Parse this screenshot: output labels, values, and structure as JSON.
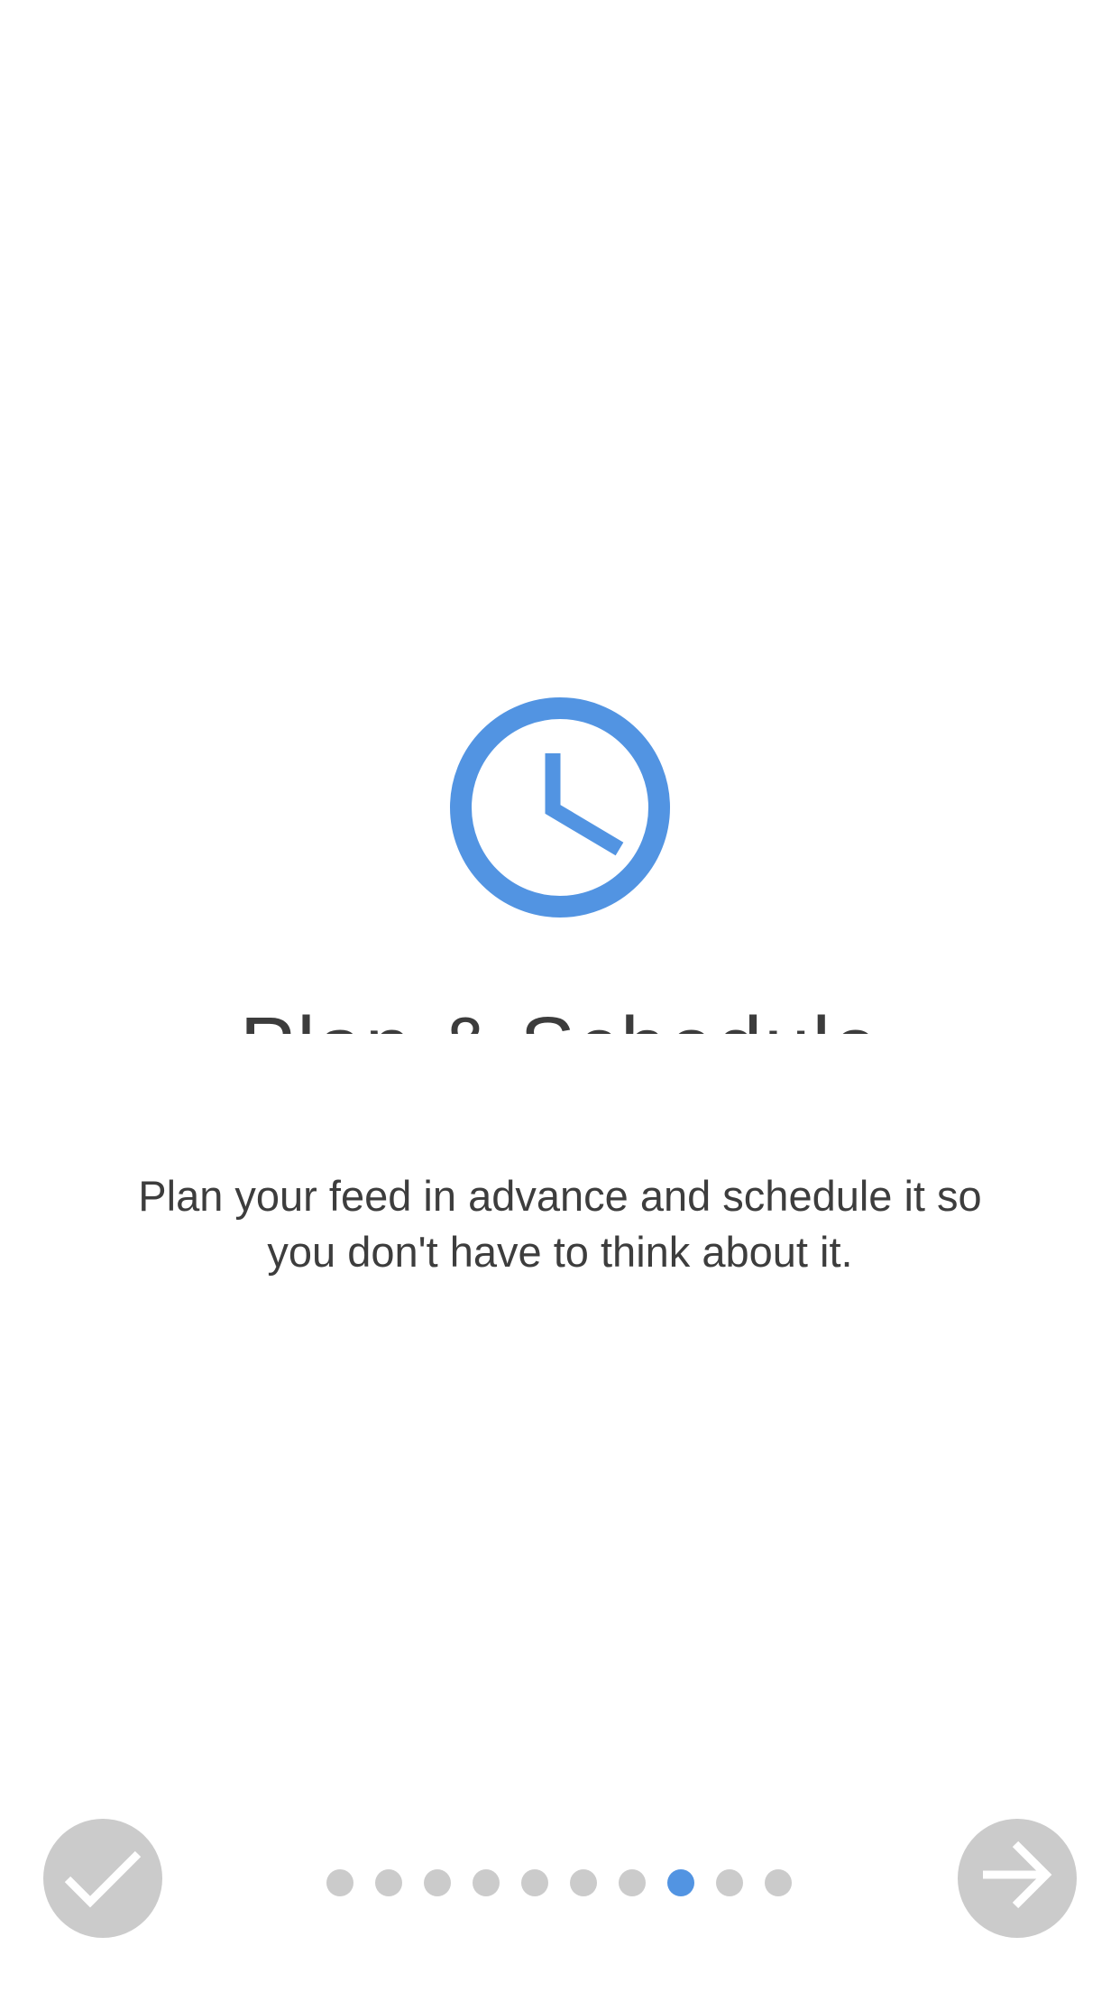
{
  "onboarding": {
    "title": "Plan & Schedule",
    "description_line1": "Plan your feed in advance and schedule it so",
    "description_line2": "you don't have to think about it."
  },
  "icons": {
    "feature": "clock-icon",
    "done": "checkmark-icon",
    "next": "arrow-right-icon"
  },
  "pager": {
    "total_pages": 10,
    "current_page": 8
  },
  "colors": {
    "accent": "#5294e2",
    "inactive": "#cbcbcb",
    "text": "#3d3d3d",
    "background": "#ffffff"
  }
}
